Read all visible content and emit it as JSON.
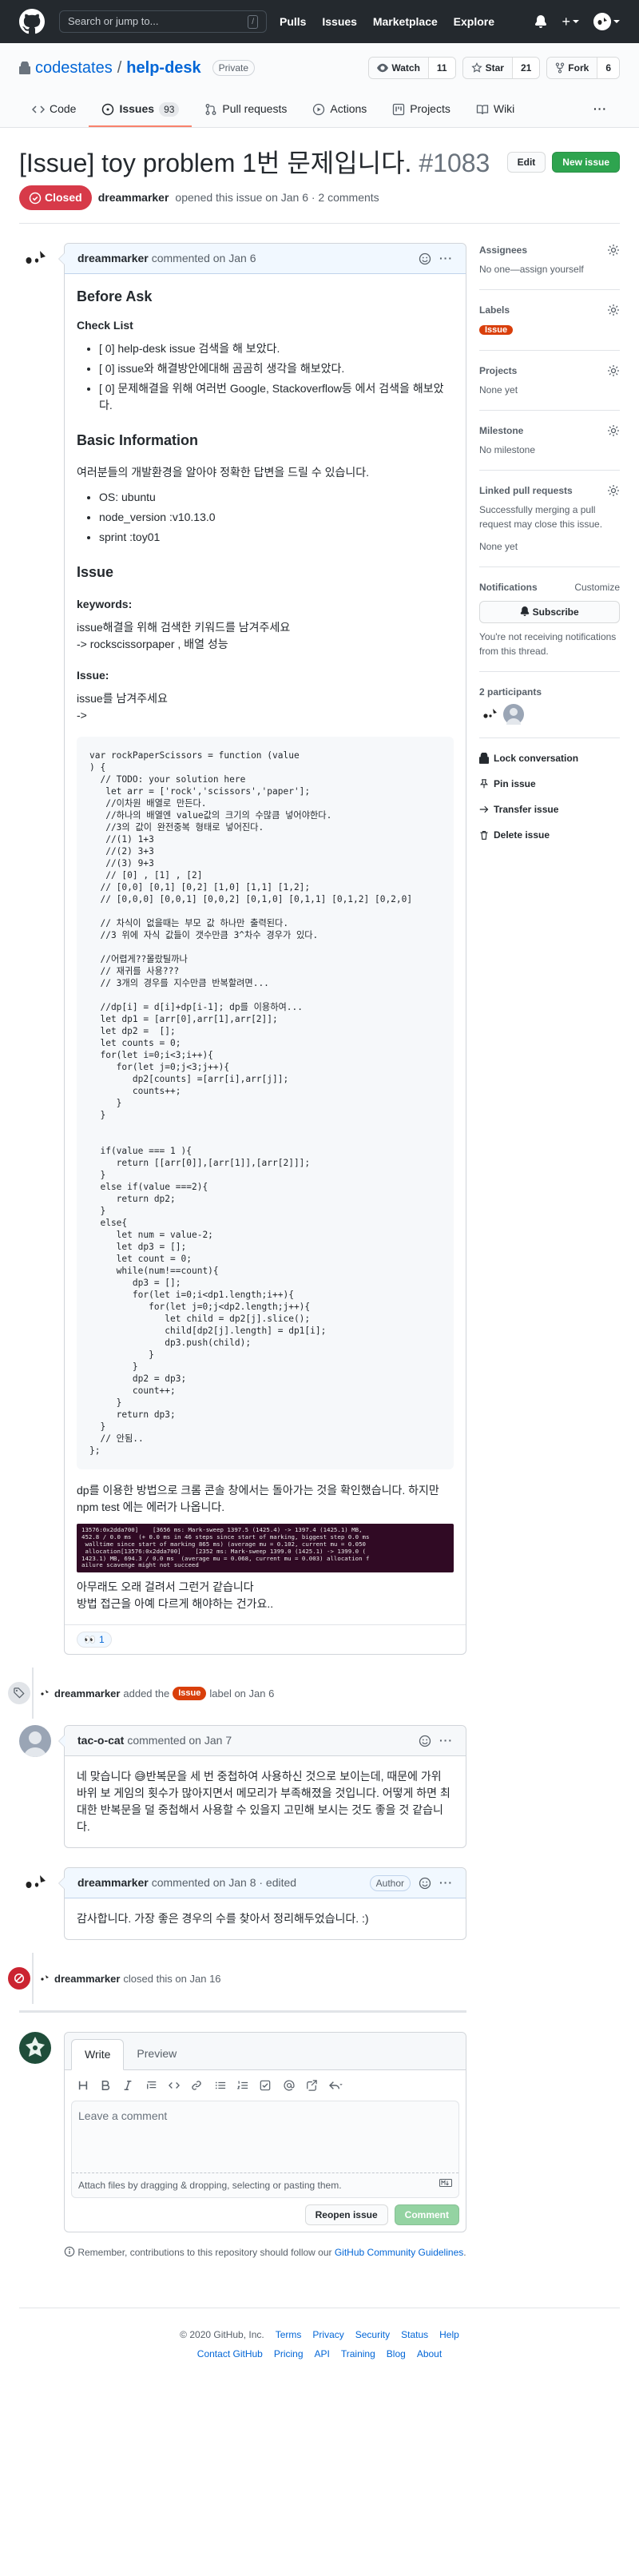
{
  "header": {
    "search_placeholder": "Search or jump to...",
    "slash": "/",
    "nav": [
      "Pulls",
      "Issues",
      "Marketplace",
      "Explore"
    ],
    "plus": "+"
  },
  "repo": {
    "owner": "codestates",
    "sep": "/",
    "name": "help-desk",
    "visibility": "Private",
    "watch_label": "Watch",
    "watch_count": "11",
    "star_label": "Star",
    "star_count": "21",
    "fork_label": "Fork",
    "fork_count": "6"
  },
  "tabs": [
    {
      "label": "Code"
    },
    {
      "label": "Issues",
      "count": "93"
    },
    {
      "label": "Pull requests"
    },
    {
      "label": "Actions"
    },
    {
      "label": "Projects"
    },
    {
      "label": "Wiki"
    }
  ],
  "issue": {
    "title": "[Issue] toy problem 1번 문제입니다.",
    "number": "#1083",
    "edit_label": "Edit",
    "new_label": "New issue",
    "state": "Closed",
    "author": "dreammarker",
    "meta": "opened this issue on Jan 6 · 2 comments"
  },
  "comment1": {
    "author": "dreammarker",
    "when": "commented on Jan 6",
    "h_before": "Before Ask",
    "h_check": "Check List",
    "checklist": [
      "[ 0] help-desk issue 검색을 해 보았다.",
      "[ 0] issue와 해결방안에대해 곰곰히 생각을 해보았다.",
      "[ 0] 문제해결을 위해 여러번 Google, Stackoverflow등 에서 검색을 해보았다."
    ],
    "h_basic": "Basic Information",
    "basic_desc": "여러분들의 개발환경을 알아야 정확한 답변을 드릴 수 있습니다.",
    "env": [
      "OS: ubuntu",
      "node_version :v10.13.0",
      "sprint :toy01"
    ],
    "h_issue": "Issue",
    "h_keywords": "keywords:",
    "kw1": "issue해결을 위해 검색한 키워드를 남겨주세요",
    "kw2": "-> rockscissorpaper , 배열 성능",
    "h_issue2": "Issue:",
    "iss1": "issue를 남겨주세요",
    "iss2": "->",
    "code": [
      "var rockPaperScissors = function (value",
      ") {",
      "  // TODO: your solution here",
      "   let arr = ['rock','scissors','paper'];",
      "   //이차원 배열로 만든다.",
      "   //하나의 배열엔 value값의 크기의 수많큼 넣어야한다.",
      "   //3의 값이 완전중복 형태로 넣어진다.",
      "   //(1) 1+3",
      "   //(2) 3+3",
      "   //(3) 9+3",
      "   // [0] , [1] , [2]",
      "  // [0,0] [0,1] [0,2] [1,0] [1,1] [1,2];",
      "  // [0,0,0] [0,0,1] [0,0,2] [0,1,0] [0,1,1] [0,1,2] [0,2,0]",
      "",
      "  // 차식이 없을때는 부모 값 하나만 출력된다.",
      "  //3 위에 자식 값들이 갯수만큼 3^차수 경우가 있다.",
      "",
      "  //어렵게??몰랐틸까나",
      "  // 재귀를 사용???",
      "  // 3개의 경우를 지수만큼 반복할려면...",
      "",
      "  //dp[i] = d[i]+dp[i-1]; dp를 이용하여...",
      "  let dp1 = [arr[0],arr[1],arr[2]];",
      "  let dp2 =  [];",
      "  let counts = 0;",
      "  for(let i=0;i<3;i++){",
      "     for(let j=0;j<3;j++){",
      "        dp2[counts] =[arr[i],arr[j]];",
      "        counts++;",
      "     }",
      "  }",
      "",
      "",
      "  if(value === 1 ){",
      "     return [[arr[0]],[arr[1]],[arr[2]]];",
      "  }",
      "  else if(value ===2){",
      "     return dp2;",
      "  }",
      "  else{",
      "     let num = value-2;",
      "     let dp3 = [];",
      "     let count = 0;",
      "     while(num!==count){",
      "        dp3 = [];",
      "        for(let i=0;i<dp1.length;i++){",
      "           for(let j=0;j<dp2.length;j++){",
      "              let child = dp2[j].slice();",
      "              child[dp2[j].length] = dp1[i];",
      "              dp3.push(child);",
      "           }",
      "        }",
      "        dp2 = dp3;",
      "        count++;",
      "     }",
      "     return dp3;",
      "  }",
      "  // 안됨..",
      "};"
    ],
    "after_code": "dp를 이용한 방법으로 크롬 콘솔 창에서는 돌아가는 것을 확인했습니다. 하지만 npm test 에는 에러가 나옵니다.",
    "terminal": [
      "13576:0x2dda700]    [3656 ms: Mark-sweep 1397.5 (1425.4) -> 1397.4 (1425.1) MB,",
      "452.8 / 0.0 ms  (+ 0.0 ms in 46 steps since start of marking, biggest step 0.0 ms",
      " walltime since start of marking 865 ms) (average mu = 0.102, current mu = 0.050",
      " allocation[13576:0x2dda700]    [2352 ms: Mark-sweep 1399.0 (1425.1) -> 1399.0 (",
      "1423.1) MB, 694.3 / 0.0 ms  (average mu = 0.068, current mu = 0.003) allocation f",
      "ailure scavenge might not succeed"
    ],
    "p_a": "아무래도 오래 걸려서 그런거 같습니다",
    "p_b": "방법 접근을 아예 다르게 해야하는 건가요..",
    "reaction_emoji": "👀",
    "reaction_count": "1"
  },
  "event_label": {
    "actor": "dreammarker",
    "action": "added the",
    "label": "Issue",
    "suffix": "label on Jan 6"
  },
  "comment2": {
    "author": "tac-o-cat",
    "when": "commented on Jan 7",
    "body": "네 맞습니다 😅반복문을 세 번 중첩하여 사용하신 것으로 보이는데, 때문에 가위 바위 보 게임의 횟수가 많아지면서 메모리가 부족해졌을 것입니다. 어떻게 하면 최대한 반복문을 덜 중첩해서 사용할 수 있을지 고민해 보시는 것도 좋을 것 같습니다."
  },
  "comment3": {
    "author": "dreammarker",
    "when": "commented on Jan 8 · edited",
    "role": "Author",
    "body": "감사합니다. 가장 좋은 경우의 수를 찾아서 정리해두었습니다. :)"
  },
  "event_close": {
    "actor": "dreammarker",
    "text": "closed this on Jan 16"
  },
  "composer": {
    "tab_write": "Write",
    "tab_preview": "Preview",
    "placeholder": "Leave a comment",
    "attach": "Attach files by dragging & dropping, selecting or pasting them.",
    "reopen": "Reopen issue",
    "submit": "Comment",
    "tip_prefix": "Remember, contributions to this repository should follow our",
    "tip_link": "GitHub Community Guidelines",
    "tip_suffix": "."
  },
  "sidebar": {
    "assignees_h": "Assignees",
    "assignees_v": "No one—assign yourself",
    "labels_h": "Labels",
    "label": "Issue",
    "projects_h": "Projects",
    "projects_v": "None yet",
    "milestone_h": "Milestone",
    "milestone_v": "No milestone",
    "linked_h": "Linked pull requests",
    "linked_desc": "Successfully merging a pull request may close this issue.",
    "linked_v": "None yet",
    "notif_h": "Notifications",
    "notif_customize": "Customize",
    "subscribe": "Subscribe",
    "notif_desc": "You're not receiving notifications from this thread.",
    "participants_h": "2 participants",
    "lock": "Lock conversation",
    "pin": "Pin issue",
    "transfer": "Transfer issue",
    "delete": "Delete issue"
  },
  "footer": {
    "copyright": "© 2020 GitHub, Inc.",
    "row1": [
      "Terms",
      "Privacy",
      "Security",
      "Status",
      "Help"
    ],
    "row2": [
      "Contact GitHub",
      "Pricing",
      "API",
      "Training",
      "Blog",
      "About"
    ]
  },
  "colors": {
    "header_bg": "#24292e",
    "closed_red": "#d73a49",
    "green": "#2ea44f",
    "label_issue": "#d93f0b",
    "link": "#0366d6"
  }
}
